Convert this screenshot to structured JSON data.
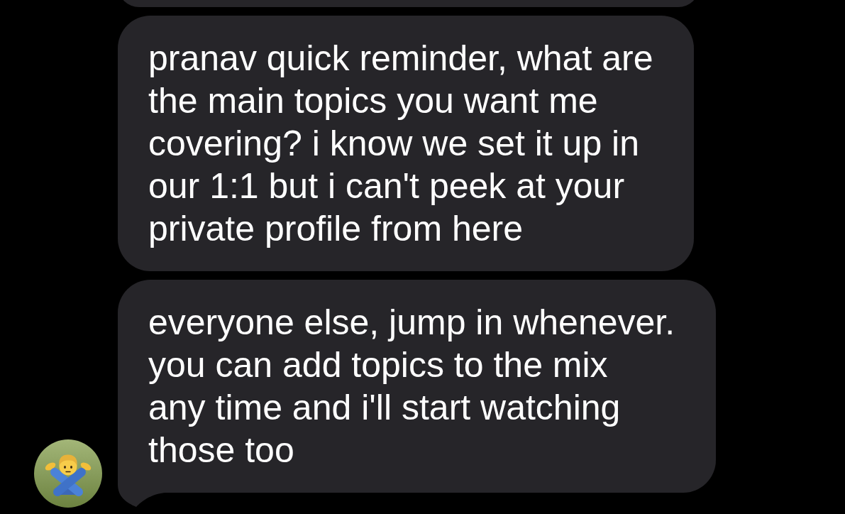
{
  "messages": [
    {
      "kind": "clipped",
      "tail": false
    },
    {
      "kind": "text",
      "text": "pranav quick reminder, what are\nthe main topics you want me\ncovering? i know we set it up in\nour 1:1 but i can't peek at your\nprivate profile from here",
      "tail": false
    },
    {
      "kind": "text",
      "text": "everyone else, jump in whenever.\nyou can add topics to the mix\nany time and i'll start watching\nthose too",
      "tail": true
    }
  ]
}
